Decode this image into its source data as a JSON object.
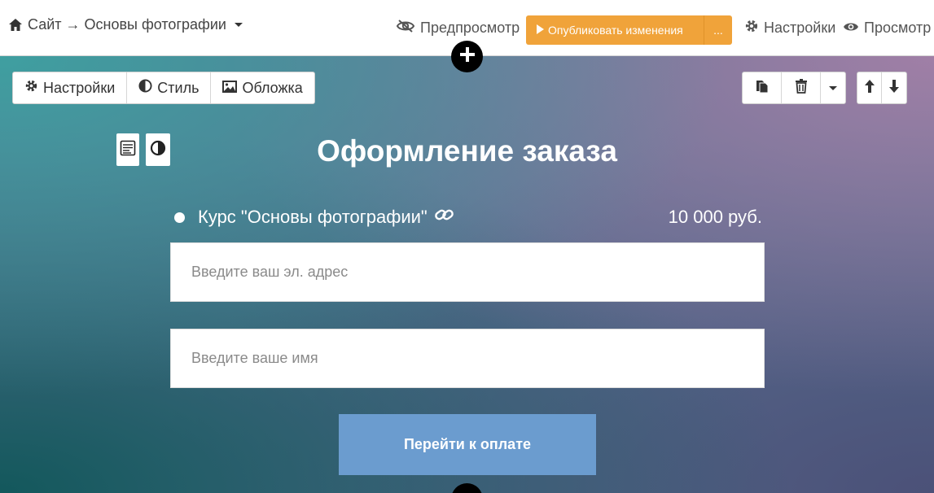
{
  "header": {
    "breadcrumb": "Сайт → Основы фотографии",
    "preview_label": "Предпросмотр",
    "publish_label": "Опубликовать изменения",
    "publish_more": "...",
    "settings_label": "Настройки",
    "view_label": "Просмотр"
  },
  "block_toolbar": {
    "settings_label": "Настройки",
    "style_label": "Стиль",
    "cover_label": "Обложка"
  },
  "form": {
    "title": "Оформление заказа",
    "product_name": "Курс \"Основы фотографии\"",
    "product_price": "10 000 руб.",
    "email_placeholder": "Введите ваш эл. адрес",
    "name_placeholder": "Введите ваше имя",
    "submit_label": "Перейти к оплате"
  },
  "colors": {
    "publish_button": "#f0a33a",
    "pay_button": "#6b9ccf"
  }
}
